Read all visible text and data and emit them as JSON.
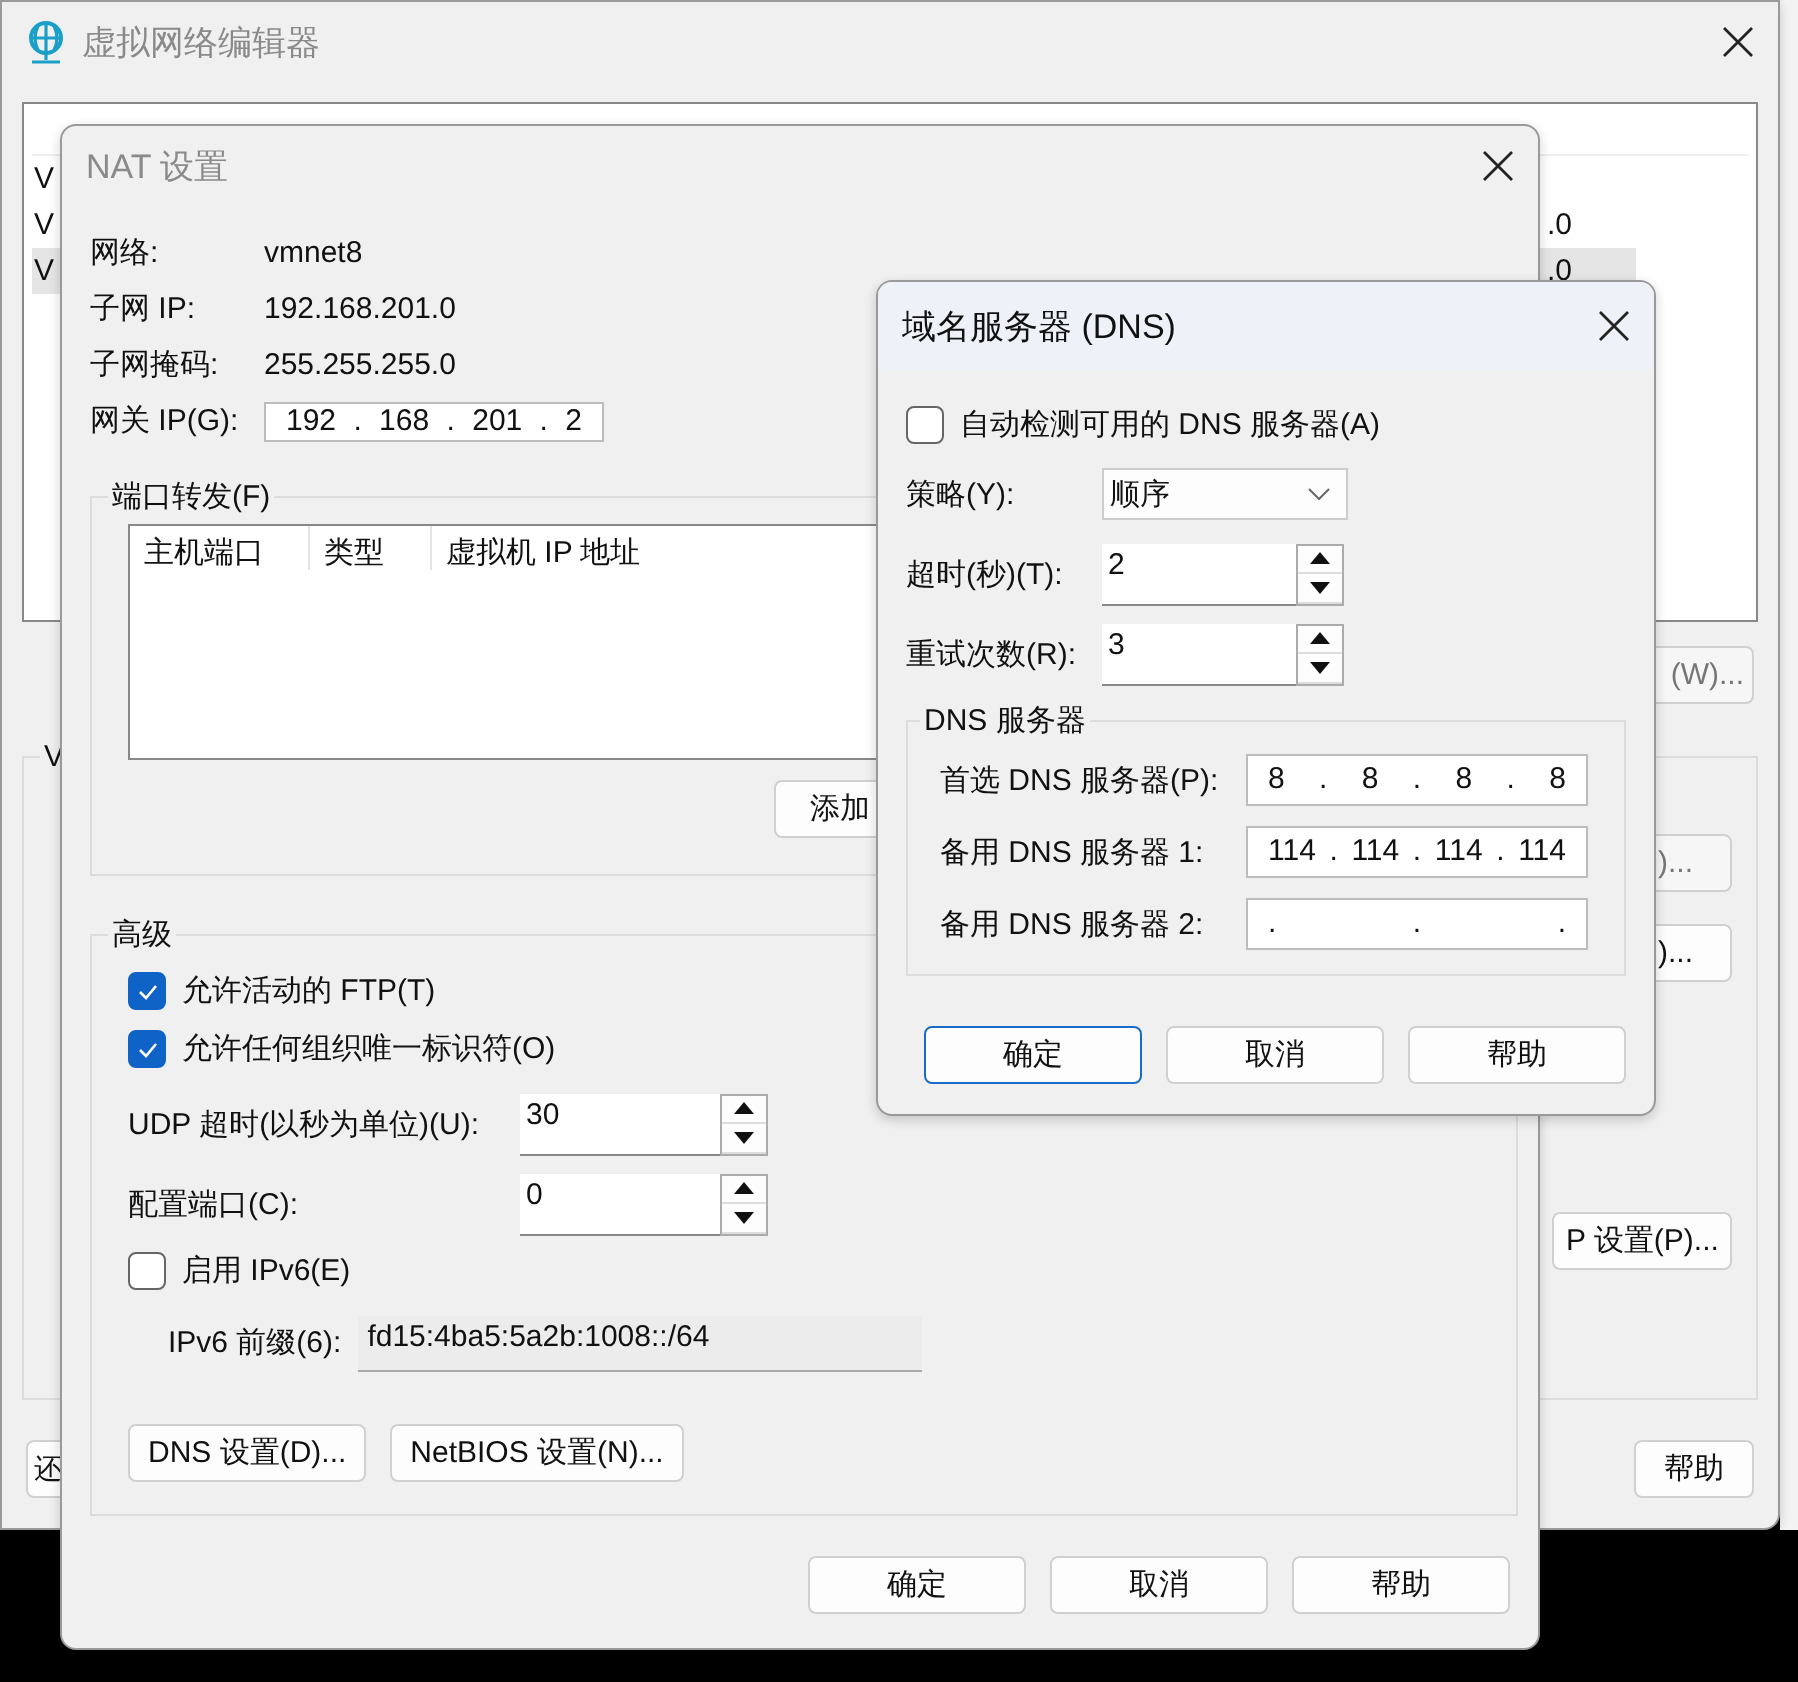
{
  "main_window": {
    "title": "虚拟网络编辑器",
    "active": false,
    "list": {
      "rows": [
        {
          "column_1": "V",
          "selected": false
        },
        {
          "column_1": "V",
          "column_6": ".0",
          "selected": false
        },
        {
          "column_1": "V",
          "column_6": ".0",
          "selected": true
        }
      ]
    },
    "list_button": {
      "label": "(W)...",
      "disabled": true
    },
    "group": {
      "label": "V",
      "buttons": [
        {
          "label": ")...",
          "disabled": true
        },
        {
          "label": ")...",
          "disabled": false
        },
        {
          "label": "P 设置(P)...",
          "disabled": false
        }
      ]
    },
    "footer_buttons": [
      "还",
      "帮助"
    ]
  },
  "nat_dialog": {
    "title": "NAT 设置",
    "active": false,
    "info": [
      {
        "label": "网络:",
        "value": "vmnet8"
      },
      {
        "label": "子网 IP:",
        "value": "192.168.201.0"
      },
      {
        "label": "子网掩码:",
        "value": "255.255.255.0"
      }
    ],
    "gateway": {
      "label": "网关 IP(G):",
      "value": "192 . 168 . 201 . 2"
    },
    "port_forwarding": {
      "title": "端口转发(F)",
      "columns": [
        "主机端口",
        "类型",
        "虚拟机 IP 地址"
      ],
      "add_button": "添加"
    },
    "advanced": {
      "title": "高级",
      "options": [
        {
          "kind": "checkbox",
          "label": "允许活动的 FTP(T)",
          "checked": true
        },
        {
          "kind": "checkbox",
          "label": "允许任何组织唯一标识符(O)",
          "checked": true
        },
        {
          "kind": "spinner",
          "label": "UDP 超时(以秒为单位)(U):",
          "value": "30"
        },
        {
          "kind": "spinner",
          "label": "配置端口(C):",
          "value": "0"
        },
        {
          "kind": "checkbox",
          "label": "启用 IPv6(E)",
          "checked": false
        },
        {
          "kind": "readonly",
          "label": "IPv6 前缀(6):",
          "value": "fd15:4ba5:5a2b:1008::/64"
        }
      ],
      "buttons": [
        "DNS 设置(D)...",
        "NetBIOS 设置(N)..."
      ]
    },
    "buttons": [
      {
        "label": "确定",
        "default": false
      },
      {
        "label": "取消",
        "default": false
      },
      {
        "label": "帮助",
        "default": false
      }
    ]
  },
  "dns_dialog": {
    "title": "域名服务器 (DNS)",
    "active": true,
    "auto_detect": {
      "label": "自动检测可用的 DNS 服务器(A)",
      "checked": false
    },
    "fields": [
      {
        "kind": "select",
        "label": "策略(Y):",
        "value": "顺序"
      },
      {
        "kind": "spinner",
        "label": "超时(秒)(T):",
        "value": "2"
      },
      {
        "kind": "spinner",
        "label": "重试次数(R):",
        "value": "3"
      }
    ],
    "servers": {
      "title": "DNS 服务器",
      "rows": [
        {
          "label": "首选 DNS 服务器(P):",
          "value": "8 . 8 . 8 . 8"
        },
        {
          "label": "备用 DNS 服务器 1:",
          "value": "114 . 114 . 114 . 114"
        },
        {
          "label": "备用 DNS 服务器 2:",
          "value": ". . ."
        }
      ]
    },
    "buttons": [
      {
        "label": "确定",
        "default": true
      },
      {
        "label": "取消",
        "default": false
      },
      {
        "label": "帮助",
        "default": false
      }
    ]
  }
}
